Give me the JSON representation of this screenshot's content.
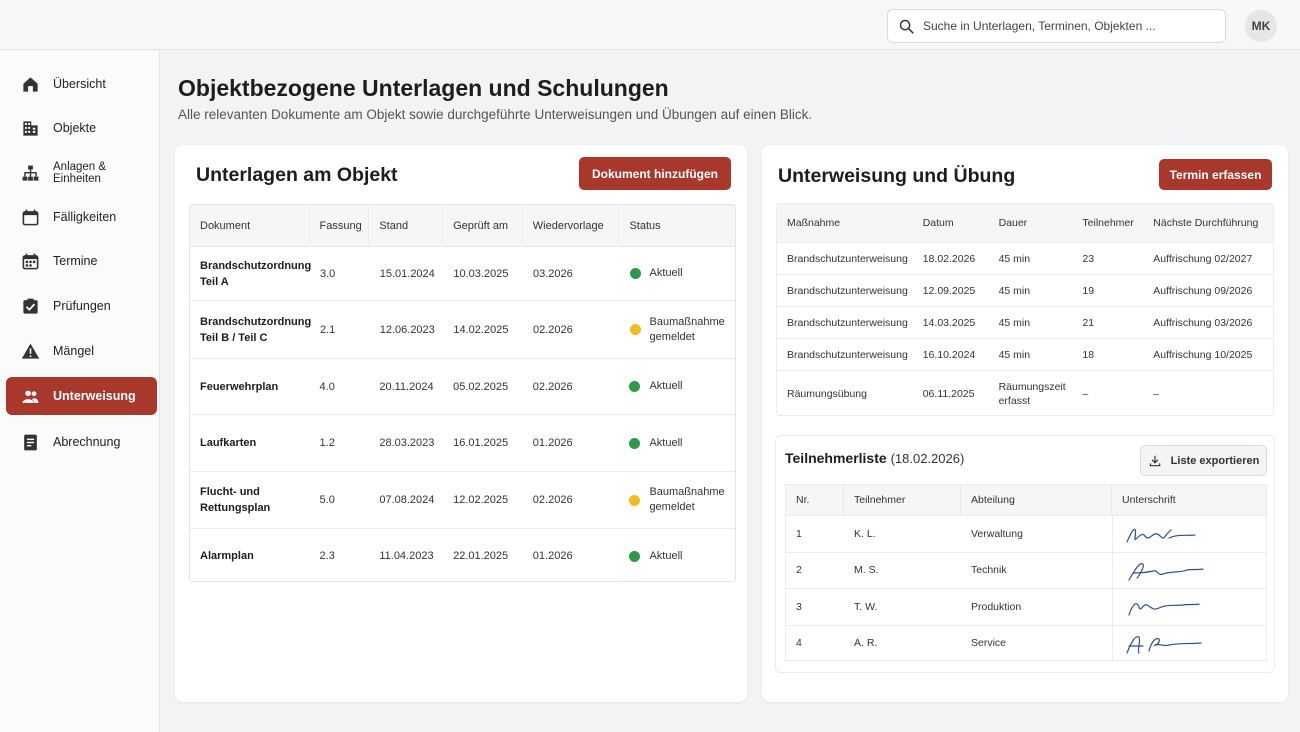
{
  "header": {
    "search_placeholder": "Suche in Unterlagen, Terminen, Objekten ...",
    "avatar_initials": "MK"
  },
  "sidebar": {
    "items": [
      {
        "label": "Übersicht",
        "icon": "home-icon"
      },
      {
        "label": "Objekte",
        "icon": "building-icon"
      },
      {
        "label": "Anlagen & Einheiten",
        "icon": "hierarchy-icon"
      },
      {
        "label": "Fälligkeiten",
        "icon": "calendar-icon"
      },
      {
        "label": "Termine",
        "icon": "calendar-grid-icon"
      },
      {
        "label": "Prüfungen",
        "icon": "checkbox-icon"
      },
      {
        "label": "Mängel",
        "icon": "warning-icon"
      },
      {
        "label": "Unterweisung",
        "icon": "people-icon",
        "active": true
      },
      {
        "label": "Abrechnung",
        "icon": "document-icon"
      }
    ]
  },
  "page": {
    "title": "Objektbezogene Unterlagen und Schulungen",
    "subtitle": "Alle relevanten Dokumente am Objekt sowie durchgeführte Unterweisungen und Übungen auf einen Blick."
  },
  "documents": {
    "title": "Unterlagen am Objekt",
    "add_button": "Dokument hinzufügen",
    "columns": [
      "Dokument",
      "Fassung",
      "Stand",
      "Geprüft am",
      "Wiedervorlage",
      "Status"
    ],
    "rows": [
      {
        "name": "Brandschutzordnung Teil A",
        "version": "3.0",
        "stand": "15.01.2024",
        "checked": "10.03.2025",
        "resubmission": "03.2026",
        "status": "Aktuell",
        "status_color": "#2e9a47"
      },
      {
        "name": "Brandschutzordnung Teil B / Teil C",
        "version": "2.1",
        "stand": "12.06.2023",
        "checked": "14.02.2025",
        "resubmission": "02.2026",
        "status": "Baumaßnahme gemeldet",
        "status_color": "#f2bd1a"
      },
      {
        "name": "Feuerwehrplan",
        "version": "4.0",
        "stand": "20.11.2024",
        "checked": "05.02.2025",
        "resubmission": "02.2026",
        "status": "Aktuell",
        "status_color": "#2e9a47"
      },
      {
        "name": "Laufkarten",
        "version": "1.2",
        "stand": "28.03.2023",
        "checked": "16.01.2025",
        "resubmission": "01.2026",
        "status": "Aktuell",
        "status_color": "#2e9a47"
      },
      {
        "name": "Flucht- und Rettungsplan",
        "version": "5.0",
        "stand": "07.08.2024",
        "checked": "12.02.2025",
        "resubmission": "02.2026",
        "status": "Baumaßnahme gemeldet",
        "status_color": "#f2bd1a"
      },
      {
        "name": "Alarmplan",
        "version": "2.3",
        "stand": "11.04.2023",
        "checked": "22.01.2025",
        "resubmission": "01.2026",
        "status": "Aktuell",
        "status_color": "#2e9a47"
      }
    ]
  },
  "training": {
    "title": "Unterweisung und Übung",
    "add_button": "Termin erfassen",
    "columns": [
      "Maßnahme",
      "Datum",
      "Dauer",
      "Teilnehmer",
      "Nächste Durchführung"
    ],
    "rows": [
      {
        "measure": "Brandschutzunterweisung",
        "date": "18.02.2026",
        "duration": "45 min",
        "participants": "23",
        "next": "Auffrischung 02/2027"
      },
      {
        "measure": "Brandschutzunterweisung",
        "date": "12.09.2025",
        "duration": "45 min",
        "participants": "19",
        "next": "Auffrischung 09/2026"
      },
      {
        "measure": "Brandschutzunterweisung",
        "date": "14.03.2025",
        "duration": "45 min",
        "participants": "21",
        "next": "Auffrischung 03/2026"
      },
      {
        "measure": "Brandschutzunterweisung",
        "date": "16.10.2024",
        "duration": "45 min",
        "participants": "18",
        "next": "Auffrischung 10/2025"
      },
      {
        "measure": "Räumungsübung",
        "date": "06.11.2025",
        "duration": "Räumungszeit erfasst",
        "participants": "–",
        "next": "–"
      }
    ]
  },
  "attendance": {
    "title": "Teilnehmerliste",
    "date": "(18.02.2026)",
    "export_button": "Liste exportieren",
    "columns": [
      "Nr.",
      "Teilnehmer",
      "Abteilung",
      "Unterschrift"
    ],
    "rows": [
      {
        "nr": "1",
        "name": "K. L.",
        "department": "Verwaltung"
      },
      {
        "nr": "2",
        "name": "M. S.",
        "department": "Technik"
      },
      {
        "nr": "3",
        "name": "T. W.",
        "department": "Produktion"
      },
      {
        "nr": "4",
        "name": "A. R.",
        "department": "Service"
      }
    ]
  },
  "colors": {
    "accent": "#a8372c",
    "ok": "#2e9a47",
    "warning": "#f2bd1a",
    "signature": "#2f4f8f"
  }
}
